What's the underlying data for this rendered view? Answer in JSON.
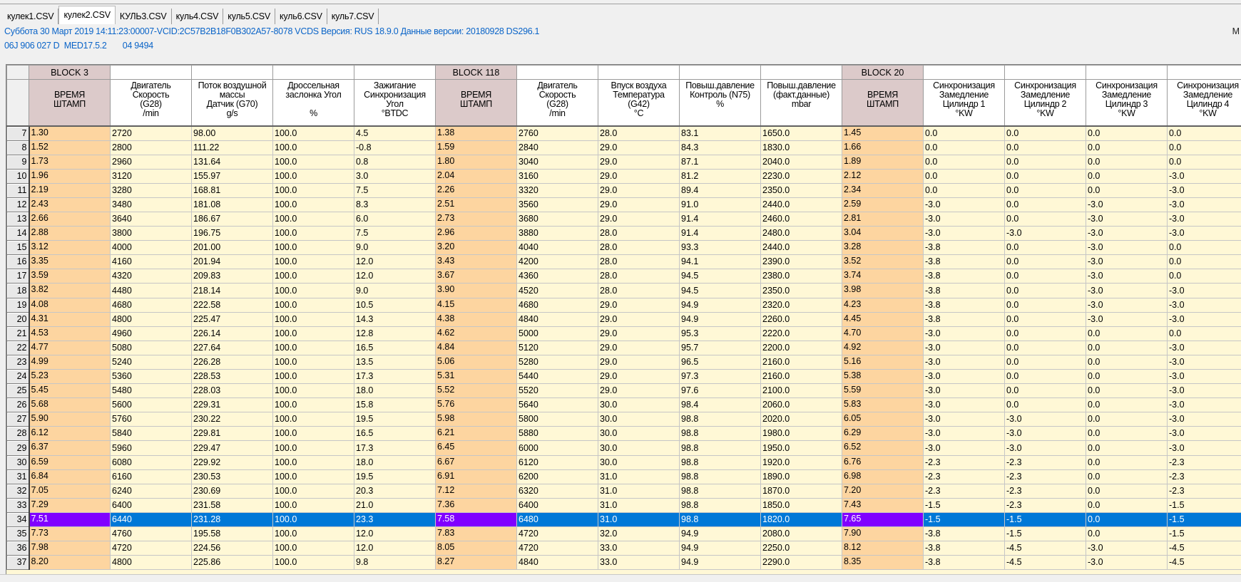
{
  "tabs": [
    "кулек1.CSV",
    "кулек2.CSV",
    "КУЛЬ3.CSV",
    "куль4.CSV",
    "куль5.CSV",
    "куль6.CSV",
    "куль7.CSV"
  ],
  "active_tab": 1,
  "info": {
    "line1": "Суббота 30 Март 2019 14:11:23:00007-VCID:2C57B2B18F0B302A57-8078 VCDS Версия: RUS 18.9.0 Данные версии: 20180928 DS296.1",
    "line2": "06J 906 027 D  MED17.5.2       04 9494",
    "right_fragment": "M"
  },
  "colors": {
    "time_col": "#fdd5a0",
    "block_header": "#dccaca",
    "cell": "#fff8d6",
    "selected": "#0078d7",
    "selected_time": "#8000ff",
    "info_text": "#0a64c8"
  },
  "blocks": [
    "BLOCK 3",
    "",
    "",
    "",
    "",
    "BLOCK 118",
    "",
    "",
    "",
    "",
    "BLOCK 20",
    "",
    "",
    "",
    ""
  ],
  "headers": [
    "ВРЕМЯ\nШТАМП",
    "Двигатель\nСкорость\n(G28)\n/min",
    "Поток воздушной\nмассы\nДатчик (G70)\ng/s",
    "Дроссельная\nзаслонка Угол\n\n%",
    "Зажигание\nСинхронизация\nУгол\n°BTDC",
    "ВРЕМЯ\nШТАМП",
    "Двигатель\nСкорость\n(G28)\n/min",
    "Впуск воздуха\nТемпература\n(G42)\n°C",
    "Повыш.давление\nКонтроль (N75)\n%",
    "Повыш.давление\n(факт.данные)\nmbar",
    "ВРЕМЯ\nШТАМП",
    "Синхронизация\nЗамедление\nЦилиндр 1\n°KW",
    "Синхронизация\nЗамедление\nЦилиндр 2\n°KW",
    "Синхронизация\nЗамедление\nЦилиндр 3\n°KW",
    "Синхронизация\nЗамедление\nЦилиндр 4\n°KW"
  ],
  "time_columns": [
    0,
    5,
    10
  ],
  "selected_row": 34,
  "rows": [
    {
      "n": 7,
      "v": [
        "1.30",
        "2720",
        "98.00",
        "100.0",
        "4.5",
        "1.38",
        "2760",
        "28.0",
        "83.1",
        "1650.0",
        "1.45",
        "0.0",
        "0.0",
        "0.0",
        "0.0"
      ]
    },
    {
      "n": 8,
      "v": [
        "1.52",
        "2800",
        "111.22",
        "100.0",
        "-0.8",
        "1.59",
        "2840",
        "29.0",
        "84.3",
        "1830.0",
        "1.66",
        "0.0",
        "0.0",
        "0.0",
        "0.0"
      ]
    },
    {
      "n": 9,
      "v": [
        "1.73",
        "2960",
        "131.64",
        "100.0",
        "0.8",
        "1.80",
        "3040",
        "29.0",
        "87.1",
        "2040.0",
        "1.89",
        "0.0",
        "0.0",
        "0.0",
        "0.0"
      ]
    },
    {
      "n": 10,
      "v": [
        "1.96",
        "3120",
        "155.97",
        "100.0",
        "3.0",
        "2.04",
        "3160",
        "29.0",
        "81.2",
        "2230.0",
        "2.12",
        "0.0",
        "0.0",
        "0.0",
        "-3.0"
      ]
    },
    {
      "n": 11,
      "v": [
        "2.19",
        "3280",
        "168.81",
        "100.0",
        "7.5",
        "2.26",
        "3320",
        "29.0",
        "89.4",
        "2350.0",
        "2.34",
        "0.0",
        "0.0",
        "0.0",
        "-3.0"
      ]
    },
    {
      "n": 12,
      "v": [
        "2.43",
        "3480",
        "181.08",
        "100.0",
        "8.3",
        "2.51",
        "3560",
        "29.0",
        "91.0",
        "2440.0",
        "2.59",
        "-3.0",
        "0.0",
        "-3.0",
        "-3.0"
      ]
    },
    {
      "n": 13,
      "v": [
        "2.66",
        "3640",
        "186.67",
        "100.0",
        "6.0",
        "2.73",
        "3680",
        "29.0",
        "91.4",
        "2460.0",
        "2.81",
        "-3.0",
        "0.0",
        "-3.0",
        "-3.0"
      ]
    },
    {
      "n": 14,
      "v": [
        "2.88",
        "3800",
        "196.75",
        "100.0",
        "7.5",
        "2.96",
        "3880",
        "28.0",
        "91.4",
        "2480.0",
        "3.04",
        "-3.0",
        "-3.0",
        "-3.0",
        "-3.0"
      ]
    },
    {
      "n": 15,
      "v": [
        "3.12",
        "4000",
        "201.00",
        "100.0",
        "9.0",
        "3.20",
        "4040",
        "28.0",
        "93.3",
        "2440.0",
        "3.28",
        "-3.8",
        "0.0",
        "-3.0",
        "0.0"
      ]
    },
    {
      "n": 16,
      "v": [
        "3.35",
        "4160",
        "201.94",
        "100.0",
        "12.0",
        "3.43",
        "4200",
        "28.0",
        "94.1",
        "2390.0",
        "3.52",
        "-3.8",
        "0.0",
        "-3.0",
        "0.0"
      ]
    },
    {
      "n": 17,
      "v": [
        "3.59",
        "4320",
        "209.83",
        "100.0",
        "12.0",
        "3.67",
        "4360",
        "28.0",
        "94.5",
        "2380.0",
        "3.74",
        "-3.8",
        "0.0",
        "-3.0",
        "0.0"
      ]
    },
    {
      "n": 18,
      "v": [
        "3.82",
        "4480",
        "218.14",
        "100.0",
        "9.0",
        "3.90",
        "4520",
        "28.0",
        "94.5",
        "2350.0",
        "3.98",
        "-3.8",
        "0.0",
        "-3.0",
        "-3.0"
      ]
    },
    {
      "n": 19,
      "v": [
        "4.08",
        "4680",
        "222.58",
        "100.0",
        "10.5",
        "4.15",
        "4680",
        "29.0",
        "94.9",
        "2320.0",
        "4.23",
        "-3.8",
        "0.0",
        "-3.0",
        "-3.0"
      ]
    },
    {
      "n": 20,
      "v": [
        "4.31",
        "4800",
        "225.47",
        "100.0",
        "14.3",
        "4.38",
        "4840",
        "29.0",
        "94.9",
        "2260.0",
        "4.45",
        "-3.8",
        "0.0",
        "-3.0",
        "-3.0"
      ]
    },
    {
      "n": 21,
      "v": [
        "4.53",
        "4960",
        "226.14",
        "100.0",
        "12.8",
        "4.62",
        "5000",
        "29.0",
        "95.3",
        "2220.0",
        "4.70",
        "-3.0",
        "0.0",
        "0.0",
        "0.0"
      ]
    },
    {
      "n": 22,
      "v": [
        "4.77",
        "5080",
        "227.64",
        "100.0",
        "16.5",
        "4.84",
        "5120",
        "29.0",
        "95.7",
        "2200.0",
        "4.92",
        "-3.0",
        "0.0",
        "0.0",
        "-3.0"
      ]
    },
    {
      "n": 23,
      "v": [
        "4.99",
        "5240",
        "226.28",
        "100.0",
        "13.5",
        "5.06",
        "5280",
        "29.0",
        "96.5",
        "2160.0",
        "5.16",
        "-3.0",
        "0.0",
        "0.0",
        "-3.0"
      ]
    },
    {
      "n": 24,
      "v": [
        "5.23",
        "5360",
        "228.53",
        "100.0",
        "17.3",
        "5.31",
        "5440",
        "29.0",
        "97.3",
        "2160.0",
        "5.38",
        "-3.0",
        "0.0",
        "0.0",
        "-3.0"
      ]
    },
    {
      "n": 25,
      "v": [
        "5.45",
        "5480",
        "228.03",
        "100.0",
        "18.0",
        "5.52",
        "5520",
        "29.0",
        "97.6",
        "2100.0",
        "5.59",
        "-3.0",
        "0.0",
        "0.0",
        "-3.0"
      ]
    },
    {
      "n": 26,
      "v": [
        "5.68",
        "5600",
        "229.31",
        "100.0",
        "15.8",
        "5.76",
        "5640",
        "30.0",
        "98.4",
        "2060.0",
        "5.83",
        "-3.0",
        "0.0",
        "0.0",
        "-3.0"
      ]
    },
    {
      "n": 27,
      "v": [
        "5.90",
        "5760",
        "230.22",
        "100.0",
        "19.5",
        "5.98",
        "5800",
        "30.0",
        "98.8",
        "2020.0",
        "6.05",
        "-3.0",
        "-3.0",
        "0.0",
        "-3.0"
      ]
    },
    {
      "n": 28,
      "v": [
        "6.12",
        "5840",
        "229.81",
        "100.0",
        "16.5",
        "6.21",
        "5880",
        "30.0",
        "98.8",
        "1980.0",
        "6.29",
        "-3.0",
        "-3.0",
        "0.0",
        "-3.0"
      ]
    },
    {
      "n": 29,
      "v": [
        "6.37",
        "5960",
        "229.47",
        "100.0",
        "17.3",
        "6.45",
        "6000",
        "30.0",
        "98.8",
        "1950.0",
        "6.52",
        "-3.0",
        "-3.0",
        "0.0",
        "-3.0"
      ]
    },
    {
      "n": 30,
      "v": [
        "6.59",
        "6080",
        "229.92",
        "100.0",
        "18.0",
        "6.67",
        "6120",
        "30.0",
        "98.8",
        "1920.0",
        "6.76",
        "-2.3",
        "-2.3",
        "0.0",
        "-2.3"
      ]
    },
    {
      "n": 31,
      "v": [
        "6.84",
        "6160",
        "230.53",
        "100.0",
        "19.5",
        "6.91",
        "6200",
        "31.0",
        "98.8",
        "1890.0",
        "6.98",
        "-2.3",
        "-2.3",
        "0.0",
        "-2.3"
      ]
    },
    {
      "n": 32,
      "v": [
        "7.05",
        "6240",
        "230.69",
        "100.0",
        "20.3",
        "7.12",
        "6320",
        "31.0",
        "98.8",
        "1870.0",
        "7.20",
        "-2.3",
        "-2.3",
        "0.0",
        "-2.3"
      ]
    },
    {
      "n": 33,
      "v": [
        "7.29",
        "6400",
        "231.58",
        "100.0",
        "21.0",
        "7.36",
        "6400",
        "31.0",
        "98.8",
        "1850.0",
        "7.43",
        "-1.5",
        "-2.3",
        "0.0",
        "-1.5"
      ]
    },
    {
      "n": 34,
      "v": [
        "7.51",
        "6440",
        "231.28",
        "100.0",
        "23.3",
        "7.58",
        "6480",
        "31.0",
        "98.8",
        "1820.0",
        "7.65",
        "-1.5",
        "-1.5",
        "0.0",
        "-1.5"
      ]
    },
    {
      "n": 35,
      "v": [
        "7.73",
        "4760",
        "195.58",
        "100.0",
        "12.0",
        "7.83",
        "4720",
        "32.0",
        "94.9",
        "2080.0",
        "7.90",
        "-3.8",
        "-1.5",
        "0.0",
        "-1.5"
      ]
    },
    {
      "n": 36,
      "v": [
        "7.98",
        "4720",
        "224.56",
        "100.0",
        "12.0",
        "8.05",
        "4720",
        "33.0",
        "94.9",
        "2250.0",
        "8.12",
        "-3.8",
        "-4.5",
        "-3.0",
        "-4.5"
      ]
    },
    {
      "n": 37,
      "v": [
        "8.20",
        "4800",
        "225.86",
        "100.0",
        "9.8",
        "8.27",
        "4840",
        "33.0",
        "94.9",
        "2290.0",
        "8.35",
        "-3.8",
        "-4.5",
        "-3.0",
        "-4.5"
      ]
    }
  ]
}
